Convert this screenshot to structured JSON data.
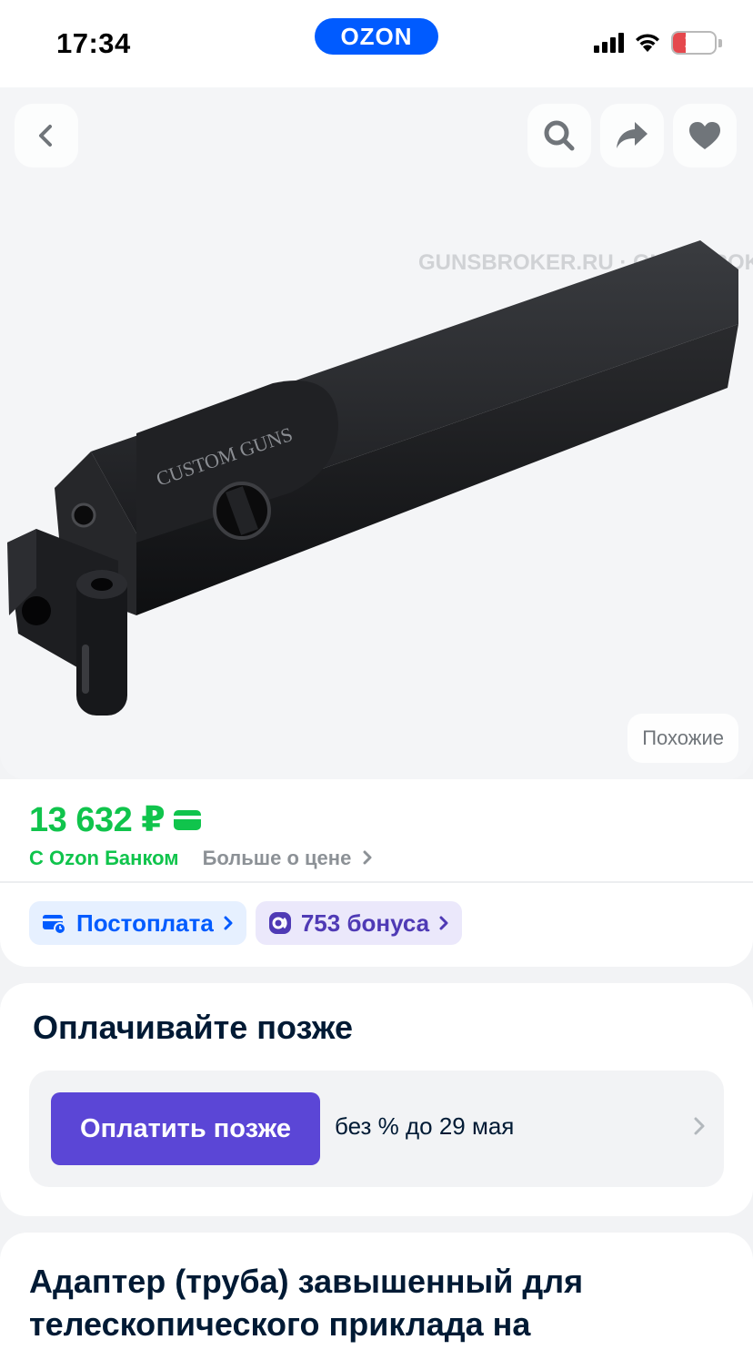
{
  "status_bar": {
    "time": "17:34",
    "battery": "15",
    "brand": "OZON"
  },
  "gallery": {
    "similar_label": "Похожие",
    "watermark": "GUNSBROKER.RU · GUNSBROKER.RU · GUNSBROKER.RU · GUNSBROKER.RU",
    "engraving": "CUSTOM GUNS"
  },
  "price": {
    "amount": "13 632 ₽",
    "bank_label": "С Ozon Банком",
    "more_label": "Больше о цене",
    "postpay_label": "Постоплата",
    "bonus_label": "753 бонуса"
  },
  "pay_later": {
    "title": "Оплачивайте позже",
    "button": "Оплатить позже",
    "terms": "без % до 29 мая"
  },
  "product": {
    "title": "Адаптер (труба) завышенный для телескопического приклада на"
  },
  "colors": {
    "accent": "#005bff",
    "price": "#10c44c",
    "pay_button": "#5b46d6"
  }
}
